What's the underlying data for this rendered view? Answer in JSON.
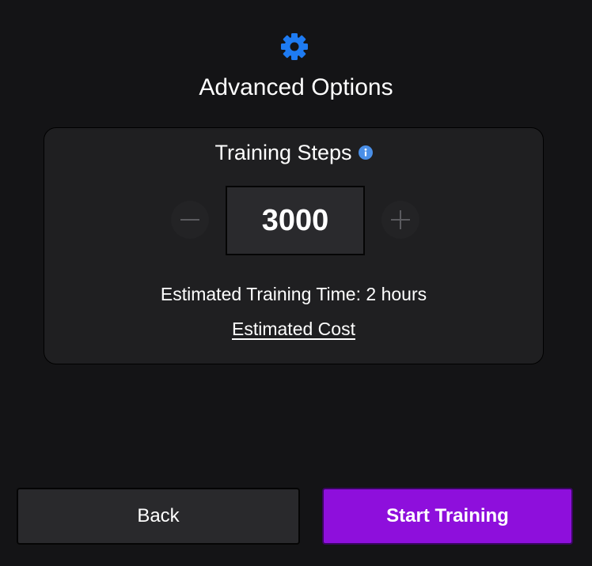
{
  "header": {
    "icon": "gear-icon",
    "icon_color": "#1e7bf2",
    "title": "Advanced Options"
  },
  "training_steps": {
    "title": "Training Steps",
    "info_icon": "info-icon",
    "info_icon_color": "#4a8fe7",
    "decrement_icon": "minus-icon",
    "increment_icon": "plus-icon",
    "value": "3000",
    "estimated_time": "Estimated Training Time: 2 hours",
    "estimated_cost_link": "Estimated Cost"
  },
  "footer": {
    "back_label": "Back",
    "start_label": "Start Training",
    "start_color": "#8e0fdc"
  }
}
